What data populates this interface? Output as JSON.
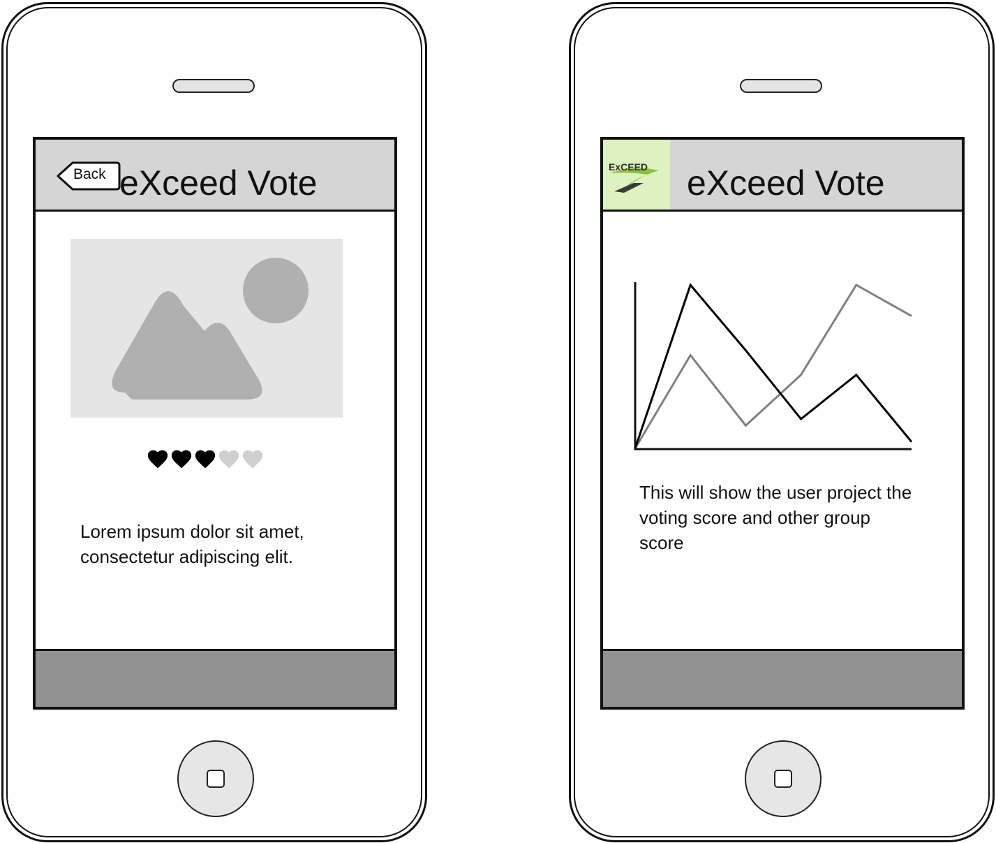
{
  "left_screen": {
    "header": {
      "back_label": "Back",
      "title": "eXceed Vote"
    },
    "rating": {
      "value": 3,
      "max": 5,
      "filled_color": "#000000",
      "empty_color": "#cfcfcf"
    },
    "body_text": "Lorem ipsum dolor sit amet, consectetur adipiscing elit."
  },
  "right_screen": {
    "header": {
      "logo_text": "ExCEED",
      "title": "eXceed Vote"
    },
    "description": "This will show the user project the voting score and other group score",
    "chart_data": {
      "type": "line",
      "title": "",
      "xlabel": "",
      "ylabel": "",
      "x": [
        0,
        1,
        2,
        3,
        4,
        5
      ],
      "series": [
        {
          "color": "#000000",
          "values": [
            0,
            100,
            60,
            18,
            45,
            4
          ]
        },
        {
          "color": "#808080",
          "values": [
            0,
            57,
            14,
            45,
            100,
            81
          ]
        }
      ],
      "ylim": [
        0,
        100
      ],
      "grid": false,
      "legend": "none"
    }
  },
  "colors": {
    "header_bg": "#d5d5d5",
    "footer_bg": "#929292",
    "logo_bg": "#dcf2c0",
    "placeholder_bg": "#e5e5e5",
    "placeholder_shape": "#b0b0b0"
  }
}
